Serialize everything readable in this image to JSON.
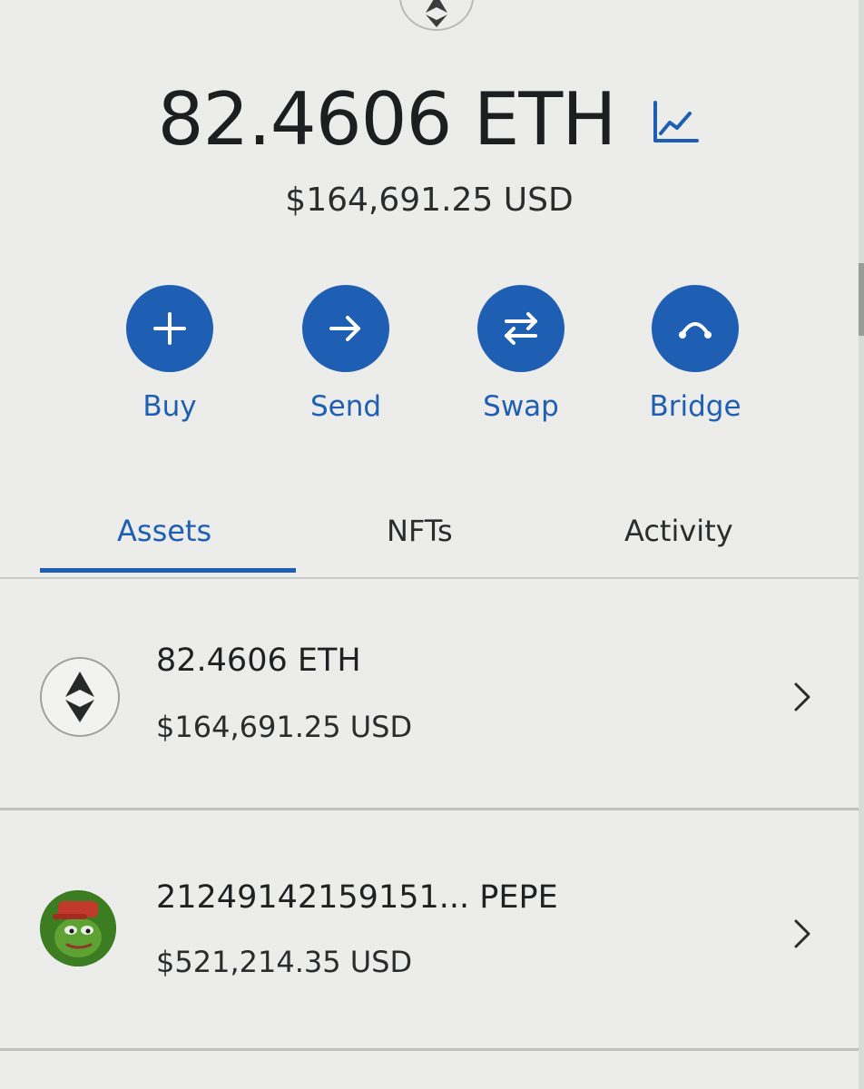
{
  "balance": {
    "amount": "82.4606 ETH",
    "fiat": "$164,691.25 USD"
  },
  "actions": [
    {
      "label": "Buy",
      "icon": "plus-icon"
    },
    {
      "label": "Send",
      "icon": "arrow-right-icon"
    },
    {
      "label": "Swap",
      "icon": "swap-arrows-icon"
    },
    {
      "label": "Bridge",
      "icon": "bridge-icon"
    }
  ],
  "tabs": [
    {
      "label": "Assets",
      "active": true
    },
    {
      "label": "NFTs",
      "active": false
    },
    {
      "label": "Activity",
      "active": false
    }
  ],
  "assets": [
    {
      "amount": "82.4606 ETH",
      "value": "$164,691.25 USD",
      "icon": "ethereum-icon"
    },
    {
      "amount": "21249142159151...  PEPE",
      "value": "$521,214.35 USD",
      "icon": "pepe-token-icon"
    }
  ],
  "colors": {
    "accent": "#1f5fb3",
    "background": "#ecedeb",
    "text": "#1f2123"
  }
}
